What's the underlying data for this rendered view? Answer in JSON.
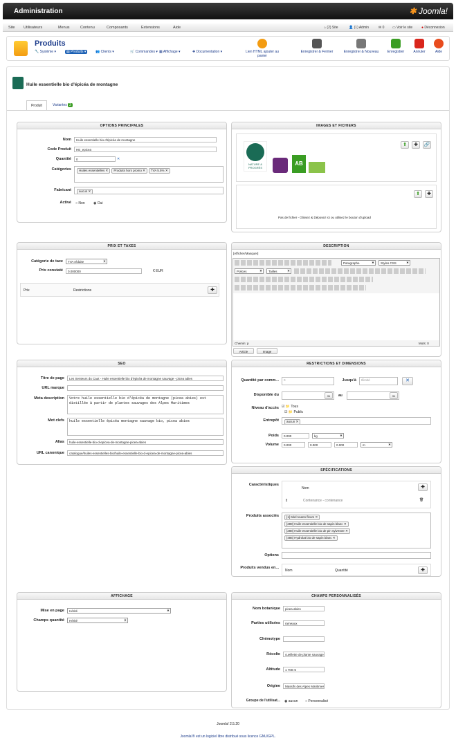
{
  "header": {
    "title": "Administration",
    "brand": "Joomla!"
  },
  "menu": [
    "Site",
    "Utilisateurs",
    "Menus",
    "Contenu",
    "Composants",
    "Extensions",
    "Aide"
  ],
  "status": {
    "site": "(2) Site",
    "admin": "(1) Admin",
    "count": "0",
    "view": "Voir le site",
    "logout": "Déconnexion"
  },
  "toolbar": {
    "title": "Produits",
    "sub": [
      "Système",
      "Produits",
      "Clients",
      "Commandes",
      "Affichage",
      "Documentation"
    ],
    "buttons": [
      "Lien HTML ajouter au panier",
      "Enregistrer & Fermer",
      "Enregistrer & Nouveau",
      "Enregistrer",
      "Annuler",
      "Aide"
    ]
  },
  "product": {
    "title": "Huile essentielle bio d'épicéa de montagne",
    "tab1": "Produit",
    "tab2": "Variantes",
    "variants": "2"
  },
  "options": {
    "header": "OPTIONS PRINCIPALES",
    "l_name": "Nom",
    "name": "Huile essentielle bio d'épicéa de montagne",
    "l_code": "Code Produit",
    "code": "HE_epicea",
    "l_qty": "Quantité",
    "qty": "0",
    "l_cat": "Catégories",
    "cats": [
      "Huiles essentielles",
      "Produits hors promo",
      "TVA 5.5%"
    ],
    "l_man": "Fabricant",
    "man": "aucun",
    "l_act": "Activé",
    "no": "Non",
    "yes": "Oui"
  },
  "images": {
    "header": "IMAGES ET FICHIERS",
    "logo1": "NATURE & PROGRÈS",
    "logo2": "AB",
    "nofile": "Pas de fichier - Glissez & Déposez ici ou utilisez le bouton d'upload"
  },
  "prices": {
    "header": "PRIX ET TAXES",
    "l_tax": "Catégorie de taxe",
    "tax": "TVA réduite",
    "l_cost": "Prix constaté",
    "cost": "0.000000",
    "cur": "€ EUR",
    "col1": "Prix",
    "col2": "Restrictions"
  },
  "desc": {
    "header": "DESCRIPTION",
    "toggle": "[Afficher/Masquer]",
    "para": "Paragraphe",
    "styles": "Styles CSS",
    "fonts": "Polices",
    "size": "Tailles",
    "path": "Chemin: p",
    "words": "Mots: 0",
    "btn1": "Article",
    "btn2": "Image"
  },
  "seo": {
    "header": "SEO",
    "l_title": "Titre de page",
    "title": "Les Senteurs du Caut - Huile essentielle bio d'épicéa de montagne sauvage - picea abies",
    "l_url": "URL marque",
    "l_meta": "Meta description",
    "meta": "Votre huile essentielle bio d'épicéa de montagne (picea abies) est distillée à partir de plantes sauvages des Alpes Maritimes",
    "l_kw": "Mot clefs",
    "kw": "huile essentielle épicéa montagne sauvage bio, picea abies",
    "l_alias": "Alias",
    "alias": "huile-essentielle-bio-d-epicea-de-montagne-picea-abies",
    "l_canon": "URL canonique",
    "canon": "catalogue/huiles-essentielles-bio/huile-essentielle-bio-d-epicea-de-montagne-picea-abies"
  },
  "restr": {
    "header": "RESTRICTIONS ET DIMENSIONS",
    "l_qty": "Quantité par comm...",
    "qty": "0",
    "l_to": "Jusqu'à",
    "unl": "Illimité",
    "l_avail": "Disponible du",
    "l_au": "au",
    "l_access": "Niveau d'accès",
    "all": "Tous",
    "pub": "Public",
    "l_wh": "Entrepôt",
    "wh": "aucun",
    "l_w": "Poids",
    "w": "0.000",
    "wu": "kg",
    "l_v": "Volume",
    "v1": "0.000",
    "v2": "0.000",
    "v3": "0.000",
    "vu": "m"
  },
  "specs": {
    "header": "SPÉCIFICATIONS",
    "l_car": "Caractéristiques",
    "col_name": "Nom",
    "row1": "Contenance - contenance",
    "l_rel": "Produits associés",
    "rel": [
      "[1] Miel toutes fleurs",
      "[289] Huile essentielle bio de sapin blanc",
      "[288] Huile essentielle bio de pin sylvestre",
      "[486] Hydrolat bio de sapin blanc"
    ],
    "l_opt": "Options",
    "l_sold": "Produits vendus en...",
    "c1": "Nom",
    "c2": "Quantité"
  },
  "display": {
    "header": "AFFICHAGE",
    "l_layout": "Mise en page",
    "layout": "Hérité",
    "l_qf": "Champs quantité",
    "qf": "Hérité"
  },
  "custom": {
    "header": "CHAMPS PERSONNALISÉS",
    "l_bot": "Nom botanique",
    "bot": "picea abies",
    "l_parts": "Parties utilisées",
    "parts": "rameaux",
    "l_chemo": "Chémotype",
    "l_harv": "Récolte",
    "harv": "cueillette de plante sauvage",
    "l_alt": "Altitude",
    "alt": "1 700 m",
    "l_orig": "Origine",
    "orig": "Massifs des Alpes Maritimes",
    "l_grp": "Groupe de l'utilisat...",
    "none": "aucun",
    "perso": "Personnalisé"
  },
  "footer": {
    "version": "Joomla! 2.5.20",
    "license": "Joomla!® est un logiciel libre distribué sous licence GNU/GPL."
  },
  "colors": {
    "accent": "#1a3a8a",
    "green": "#3a9d23"
  }
}
